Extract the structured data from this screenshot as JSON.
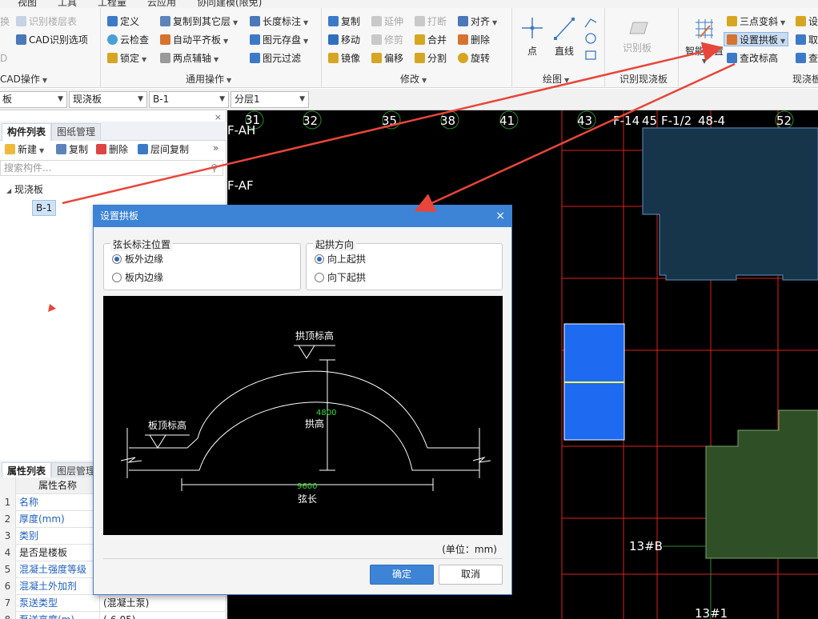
{
  "menu": {
    "view": "视图",
    "tools": "工具",
    "engineering": "工程量",
    "cloud": "云应用",
    "collab": "协同建模(限免)"
  },
  "ribbon": {
    "cad_group": {
      "item1": "换",
      "item2": "识别楼层表",
      "item3": "CAD识别选项",
      "item4": "D",
      "title": "CAD操作"
    },
    "general": {
      "define": "定义",
      "cloud_check": "云检查",
      "lock": "锁定",
      "copy_to_other": "复制到其它层",
      "auto_flat": "自动平齐板",
      "two_point_axis": "两点辅轴",
      "length_mark": "长度标注",
      "elem_save": "图元存盘",
      "elem_filter": "图元过滤",
      "title": "通用操作"
    },
    "modify": {
      "copy": "复制",
      "extend": "延伸",
      "break": "打断",
      "align": "对齐",
      "move": "移动",
      "trim": "修剪",
      "merge": "合并",
      "delete": "删除",
      "mirror": "镜像",
      "offset": "偏移",
      "split": "分割",
      "rotate": "旋转",
      "title": "修改"
    },
    "draw": {
      "point": "点",
      "line": "直线",
      "title": "绘图"
    },
    "recognize": {
      "recog_slab": "识别板",
      "title": "识别现浇板"
    },
    "slab": {
      "smart_layout": "智能布置",
      "three_point": "三点变斜",
      "set_arch": "设置拱板",
      "check_elev": "查改标高",
      "cut1": "设",
      "cut2": "取",
      "cut3": "查",
      "title": "现浇板"
    }
  },
  "selectors": {
    "s1": "板",
    "s2": "现浇板",
    "s3": "B-1",
    "s4": "分层1"
  },
  "left_panel": {
    "tab_components": "构件列表",
    "tab_drawings": "图纸管理",
    "new": "新建",
    "copy": "复制",
    "delete": "删除",
    "floor_copy": "层间复制",
    "search_placeholder": "搜索构件...",
    "tree_root": "现浇板",
    "tree_item": "B-1"
  },
  "props": {
    "tab_props": "属性列表",
    "tab_layers": "图层管理",
    "header": "属性名称",
    "rows": [
      {
        "n": "1",
        "name": "名称",
        "val": ""
      },
      {
        "n": "2",
        "name": "厚度(mm)",
        "val": ""
      },
      {
        "n": "3",
        "name": "类别",
        "val": ""
      },
      {
        "n": "4",
        "name": "是否是楼板",
        "val": ""
      },
      {
        "n": "5",
        "name": "混凝土强度等级",
        "val": ""
      },
      {
        "n": "6",
        "name": "混凝土外加剂",
        "val": ""
      },
      {
        "n": "7",
        "name": "泵送类型",
        "val": "(混凝土泵)"
      },
      {
        "n": "8",
        "name": "泵送高度(m)",
        "val": "(-6.05)"
      }
    ]
  },
  "canvas": {
    "axes": [
      "31",
      "32",
      "35",
      "38",
      "41",
      "43",
      "F-14",
      "45",
      "F-1/2",
      "48-4",
      "52"
    ],
    "left_labels": [
      "F-AH",
      "F-AF"
    ],
    "bottom_labels": [
      "13#B",
      "13#1"
    ]
  },
  "dialog": {
    "title": "设置拱板",
    "close": "×",
    "chord_group": "弦长标注位置",
    "chord_outer": "板外边缘",
    "chord_inner": "板内边缘",
    "dir_group": "起拱方向",
    "dir_up": "向上起拱",
    "dir_down": "向下起拱",
    "preview": {
      "top_elev": "拱顶标高",
      "slab_top": "板顶标高",
      "rise_value": "4800",
      "rise_label": "拱高",
      "chord_value": "9600",
      "chord_label": "弦长"
    },
    "unit": "(单位：mm)",
    "ok": "确定",
    "cancel": "取消"
  },
  "colors": {
    "accent": "#3d84d6",
    "arrow": "#e8463a",
    "cad_red": "#ff2a2a",
    "cad_green": "#2f5a2a",
    "cad_blue": "#1a66ff"
  }
}
